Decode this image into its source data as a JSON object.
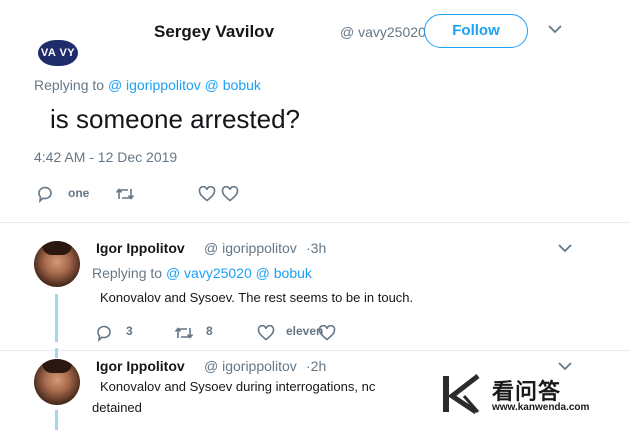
{
  "main_tweet": {
    "display_name": "Sergey Vavilov",
    "handle": "@ vavy25020",
    "follow_label": "Follow",
    "avatar_text": "VA VY",
    "replying_prefix": "Replying to",
    "replying_to": [
      "@ igorippolitov",
      "@ bobuk"
    ],
    "text": "is someone arrested?",
    "timestamp": "4:42 AM - 12 Dec 2019",
    "actions": {
      "reply_count": "one",
      "retweet_count": "",
      "like_count": ""
    }
  },
  "replies": [
    {
      "display_name": "Igor Ippolitov",
      "handle": "@ igorippolitov",
      "time": "·3h",
      "replying_prefix": "Replying to",
      "replying_to": [
        "@ vavy25020",
        "@ bobuk"
      ],
      "text": "Konovalov and Sysoev.  The rest seems to be in touch.",
      "actions": {
        "reply_count": "3",
        "retweet_count": "8",
        "like_count": "eleven"
      }
    },
    {
      "display_name": "Igor Ippolitov",
      "handle": "@ igorippolitov",
      "time": "·2h",
      "text_line1": "Konovalov and Sysoev during interrogations, nc",
      "text_line2": "detained"
    }
  ],
  "watermark": {
    "chinese": "看问答",
    "url": "www.kanwenda.com"
  },
  "colors": {
    "accent": "#1da1f2",
    "muted": "#657786",
    "thread_line": "#9fd9ea",
    "text": "#14171a"
  }
}
